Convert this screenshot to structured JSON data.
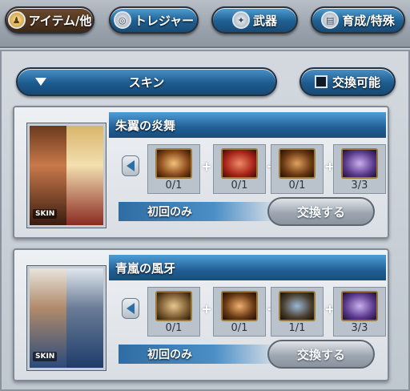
{
  "tabs": [
    {
      "label": "アイテム/他",
      "icon": "potion-icon",
      "active": true
    },
    {
      "label": "トレジャー",
      "icon": "treasure-icon",
      "active": false
    },
    {
      "label": "武器",
      "icon": "sword-icon",
      "active": false
    },
    {
      "label": "育成/特殊",
      "icon": "card-icon",
      "active": false
    }
  ],
  "filter": {
    "label": "スキン"
  },
  "toggle": {
    "label": "交換可能"
  },
  "items": [
    {
      "name": "朱翼の炎舞",
      "thumb_label": "SKIN",
      "materials": [
        {
          "count": "0/1",
          "color": "#8a4a1a"
        },
        {
          "count": "0/1",
          "color": "#a82418"
        },
        {
          "count": "0/1",
          "color": "#6b3812"
        },
        {
          "count": "3/3",
          "color": "#5b3a8c"
        }
      ],
      "limit": "初回のみ",
      "button": "交換する"
    },
    {
      "name": "青嵐の風牙",
      "thumb_label": "SKIN",
      "materials": [
        {
          "count": "0/1",
          "color": "#7a5a30"
        },
        {
          "count": "0/1",
          "color": "#6a3a14"
        },
        {
          "count": "1/1",
          "color": "#4a4030"
        },
        {
          "count": "3/3",
          "color": "#5b3a8c"
        }
      ],
      "limit": "初回のみ",
      "button": "交換する"
    }
  ]
}
